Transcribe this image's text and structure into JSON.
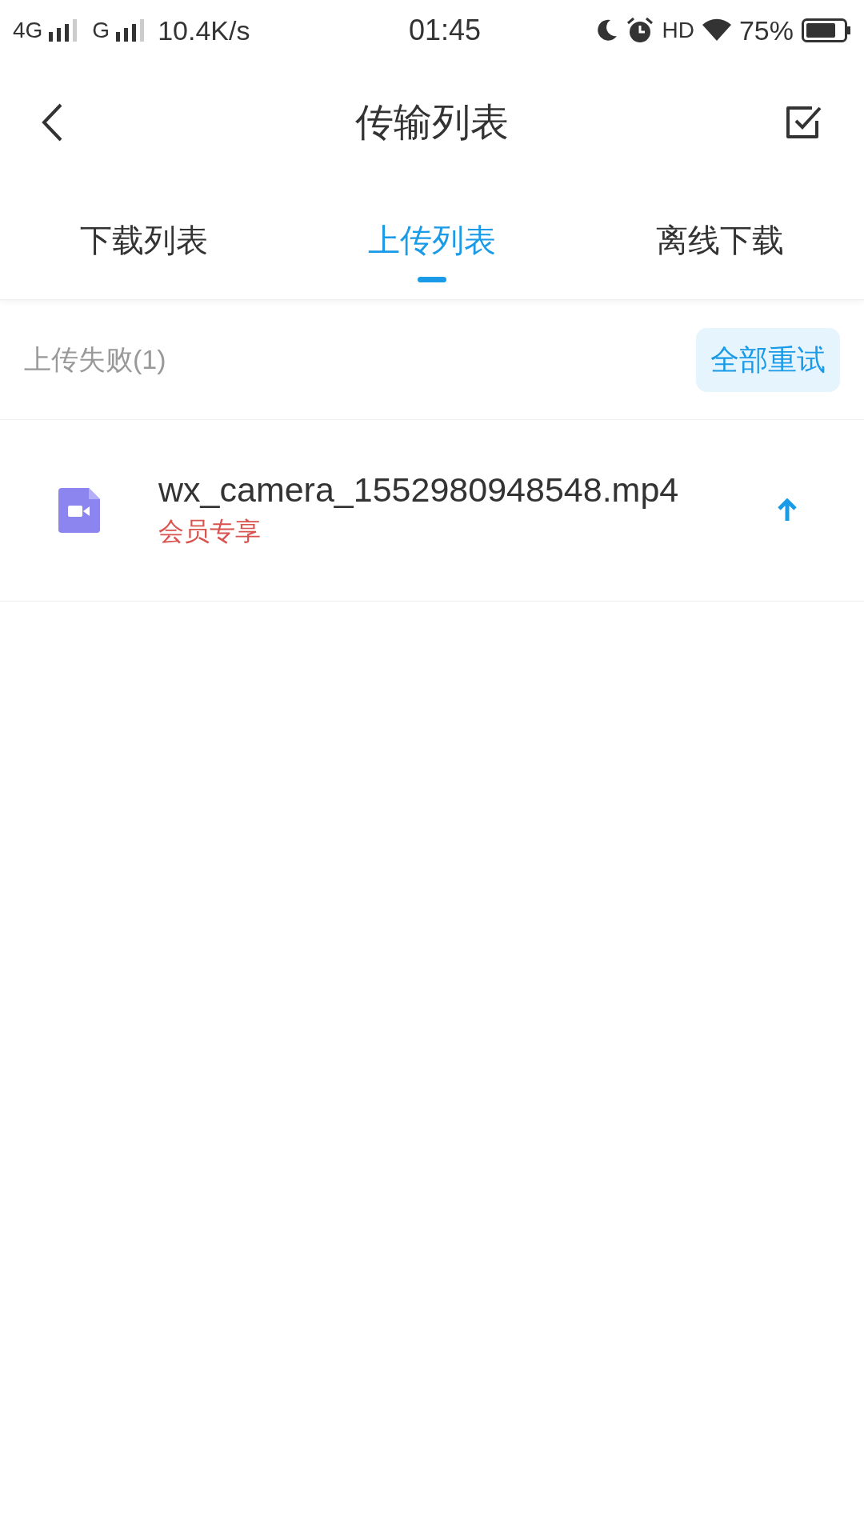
{
  "status_bar": {
    "network_1": "4G",
    "network_2": "G",
    "speed": "10.4K/s",
    "time": "01:45",
    "hd": "HD",
    "battery": "75%"
  },
  "header": {
    "title": "传输列表"
  },
  "tabs": [
    {
      "label": "下载列表",
      "selected": false
    },
    {
      "label": "上传列表",
      "selected": true
    },
    {
      "label": "离线下载",
      "selected": false
    }
  ],
  "section": {
    "title": "上传失败(1)",
    "button": "全部重试"
  },
  "files": [
    {
      "name": "wx_camera_1552980948548.mp4",
      "note": "会员专享"
    }
  ]
}
